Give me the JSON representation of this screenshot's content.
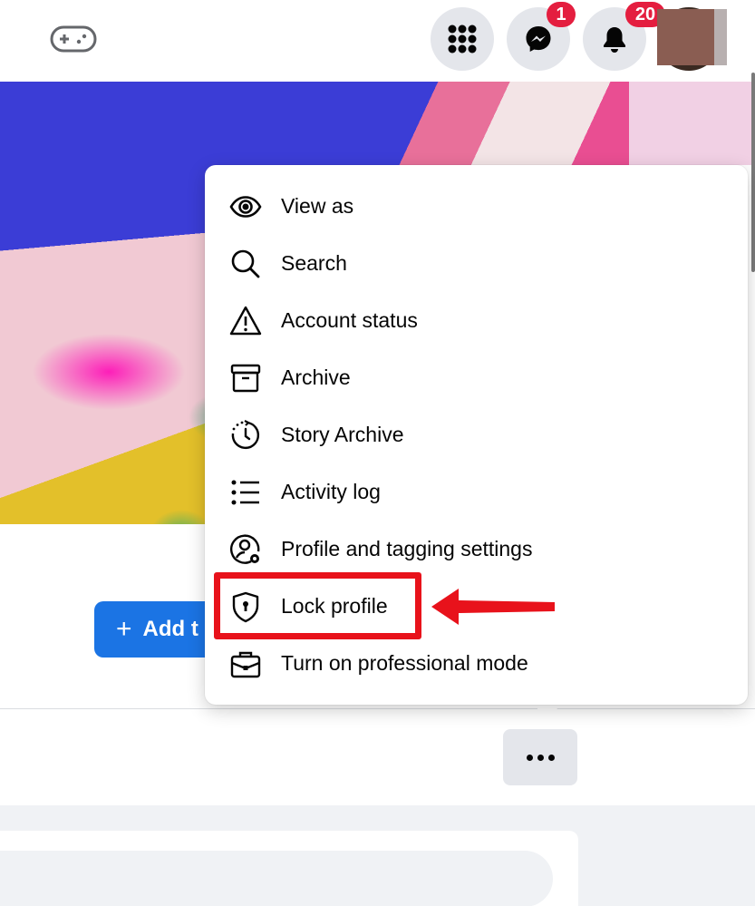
{
  "topbar": {
    "gaming_icon": "gamepad-icon",
    "menu_icon": "grid-menu-icon",
    "messenger_icon": "messenger-icon",
    "messenger_badge": "1",
    "notifications_icon": "bell-icon",
    "notifications_badge": "20"
  },
  "profile": {
    "add_story_label": "Add t",
    "more_button_icon": "ellipsis-icon"
  },
  "menu": {
    "items": [
      {
        "label": "View as",
        "icon": "eye-icon"
      },
      {
        "label": "Search",
        "icon": "search-icon"
      },
      {
        "label": "Account status",
        "icon": "warning-icon"
      },
      {
        "label": "Archive",
        "icon": "archive-box-icon"
      },
      {
        "label": "Story Archive",
        "icon": "story-clock-icon"
      },
      {
        "label": "Activity log",
        "icon": "list-icon"
      },
      {
        "label": "Profile and tagging settings",
        "icon": "profile-settings-icon"
      },
      {
        "label": "Lock profile",
        "icon": "shield-lock-icon"
      },
      {
        "label": "Turn on professional mode",
        "icon": "briefcase-icon"
      }
    ]
  },
  "annotation": {
    "highlight_color": "#e8121b",
    "highlighted_item": "Lock profile"
  },
  "colors": {
    "accent_blue": "#1b74e4",
    "badge_red": "#e41e3f",
    "button_gray": "#e4e6eb",
    "feed_bg": "#f0f2f5"
  }
}
